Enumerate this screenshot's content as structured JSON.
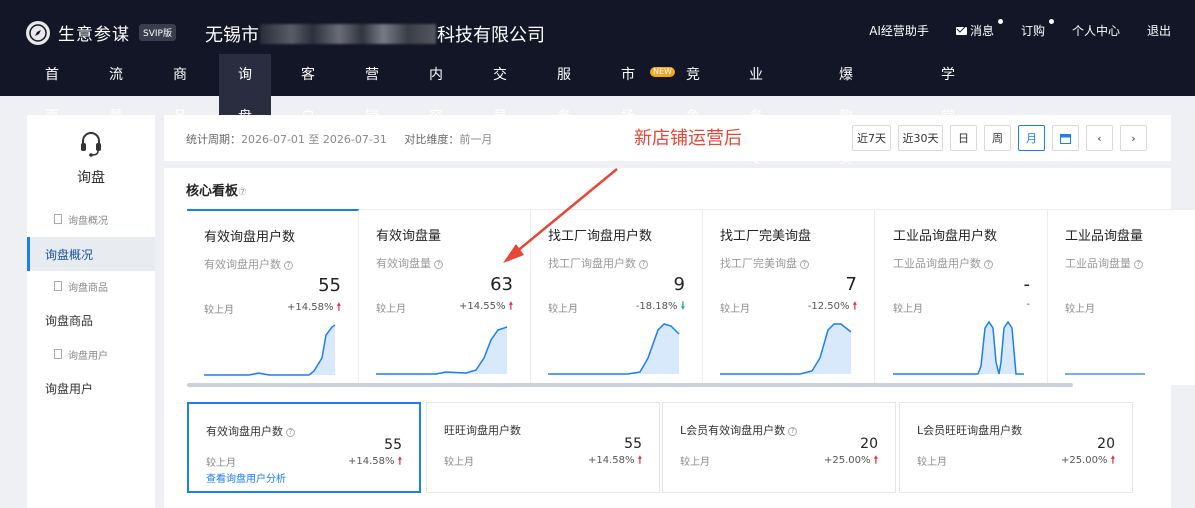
{
  "brand": {
    "name": "生意参谋",
    "badge": "SVIP版",
    "company_prefix": "无锡市",
    "company_suffix": "科技有限公司"
  },
  "top_links": {
    "ai": "AI经营助手",
    "msg": "消息",
    "order": "订购",
    "personal": "个人中心",
    "logout": "退出"
  },
  "nav": [
    "首页",
    "流量",
    "商品",
    "询盘",
    "客户",
    "营销",
    "内容",
    "交易",
    "服务",
    "市场",
    "竞争",
    "业务专区",
    "爆款实验室",
    "学堂"
  ],
  "nav_new_badge": "NEW",
  "sidebar": {
    "title": "询盘",
    "items": [
      {
        "label": "询盘概况",
        "kind": "sub"
      },
      {
        "label": "询盘概况",
        "kind": "main"
      },
      {
        "label": "询盘商品",
        "kind": "sub"
      },
      {
        "label": "询盘商品",
        "kind": "main"
      },
      {
        "label": "询盘用户",
        "kind": "sub"
      },
      {
        "label": "询盘用户",
        "kind": "main"
      }
    ]
  },
  "filter": {
    "period_label": "统计周期：",
    "period_value": "2026-07-01 至 2026-07-31",
    "compare_label": "对比维度：",
    "compare_value": "前一月",
    "buttons": [
      "近7天",
      "近30天",
      "日",
      "周",
      "月"
    ],
    "active_button": "月"
  },
  "annotation": "新店铺运营后",
  "panel_title": "核心看板",
  "cards": [
    {
      "title": "有效询盘用户数",
      "sub": "有效询盘用户数",
      "value": "55",
      "cmp": "较上月",
      "pct": "+14.58%",
      "dir": "up"
    },
    {
      "title": "有效询盘量",
      "sub": "有效询盘量",
      "value": "63",
      "cmp": "较上月",
      "pct": "+14.55%",
      "dir": "up"
    },
    {
      "title": "找工厂询盘用户数",
      "sub": "找工厂询盘用户数",
      "value": "9",
      "cmp": "较上月",
      "pct": "-18.18%",
      "dir": "down"
    },
    {
      "title": "找工厂完美询盘",
      "sub": "找工厂完美询盘",
      "value": "7",
      "cmp": "较上月",
      "pct": "-12.50%",
      "dir": "up"
    },
    {
      "title": "工业品询盘用户数",
      "sub": "工业品询盘用户数",
      "value": "-",
      "cmp": "较上月",
      "pct": "-",
      "dir": ""
    },
    {
      "title": "工业品询盘量",
      "sub": "工业品询盘量",
      "value": "",
      "cmp": "较上月",
      "pct": "",
      "dir": ""
    }
  ],
  "metric_cards": [
    {
      "title": "有效询盘用户数",
      "value": "55",
      "cmp": "较上月",
      "pct": "+14.58%",
      "link": "查看询盘用户分析",
      "help": true
    },
    {
      "title": "旺旺询盘用户数",
      "value": "55",
      "cmp": "较上月",
      "pct": "+14.58%",
      "link": "",
      "help": false
    },
    {
      "title": "L会员有效询盘用户数",
      "value": "20",
      "cmp": "较上月",
      "pct": "+25.00%",
      "link": "",
      "help": true
    },
    {
      "title": "L会员旺旺询盘用户数",
      "value": "20",
      "cmp": "较上月",
      "pct": "+25.00%",
      "link": "",
      "help": false
    }
  ],
  "colors": {
    "header_bg": "#131627",
    "accent": "#1a7ef4",
    "up": "#e2323a",
    "down": "#1aaf6c",
    "annotation": "#e84637"
  }
}
